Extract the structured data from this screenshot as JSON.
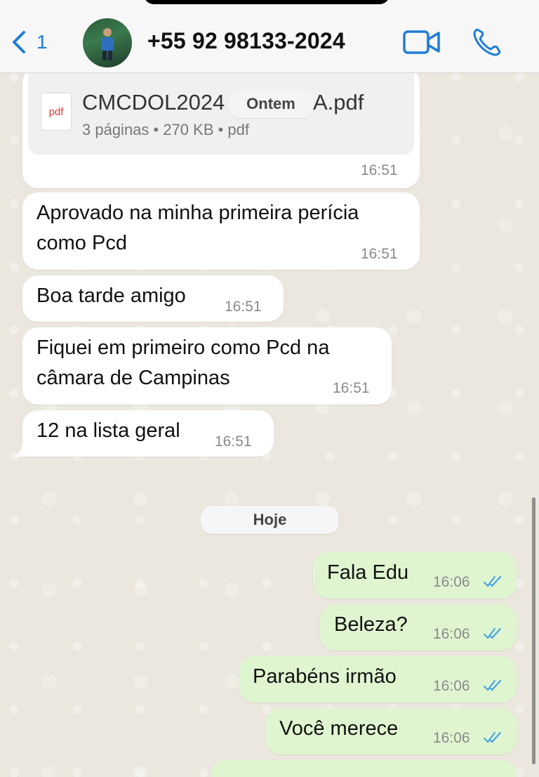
{
  "header": {
    "back_count": "1",
    "contact": "+55 92 98133-2024"
  },
  "attachment": {
    "file_name": "CMCDOL2024",
    "file_name_end": "A.pdf",
    "icon_label": "pdf",
    "meta": "3 páginas • 270 KB • pdf",
    "time": "16:51"
  },
  "date_labels": {
    "yesterday": "Ontem",
    "today": "Hoje"
  },
  "messages_in": [
    {
      "lines": [
        "Aprovado na minha primeira perícia",
        "como Pcd"
      ],
      "time": "16:51"
    },
    {
      "lines": [
        "Boa tarde amigo"
      ],
      "time": "16:51"
    },
    {
      "lines": [
        "Fiquei em primeiro como Pcd na",
        "câmara de Campinas"
      ],
      "time": "16:51"
    },
    {
      "lines": [
        "12 na lista geral"
      ],
      "time": "16:51"
    }
  ],
  "messages_out": [
    {
      "text": "Fala Edu",
      "time": "16:06",
      "status": "read"
    },
    {
      "text": "Beleza?",
      "time": "16:06",
      "status": "read"
    },
    {
      "text": "Parabéns irmão",
      "time": "16:06",
      "status": "read"
    },
    {
      "text": "Você merece",
      "time": "16:06",
      "status": "read"
    }
  ],
  "colors": {
    "accent": "#1f7dd6",
    "incoming": "#ffffff",
    "outgoing": "#dff5d0",
    "read_ticks": "#4aa3df"
  }
}
